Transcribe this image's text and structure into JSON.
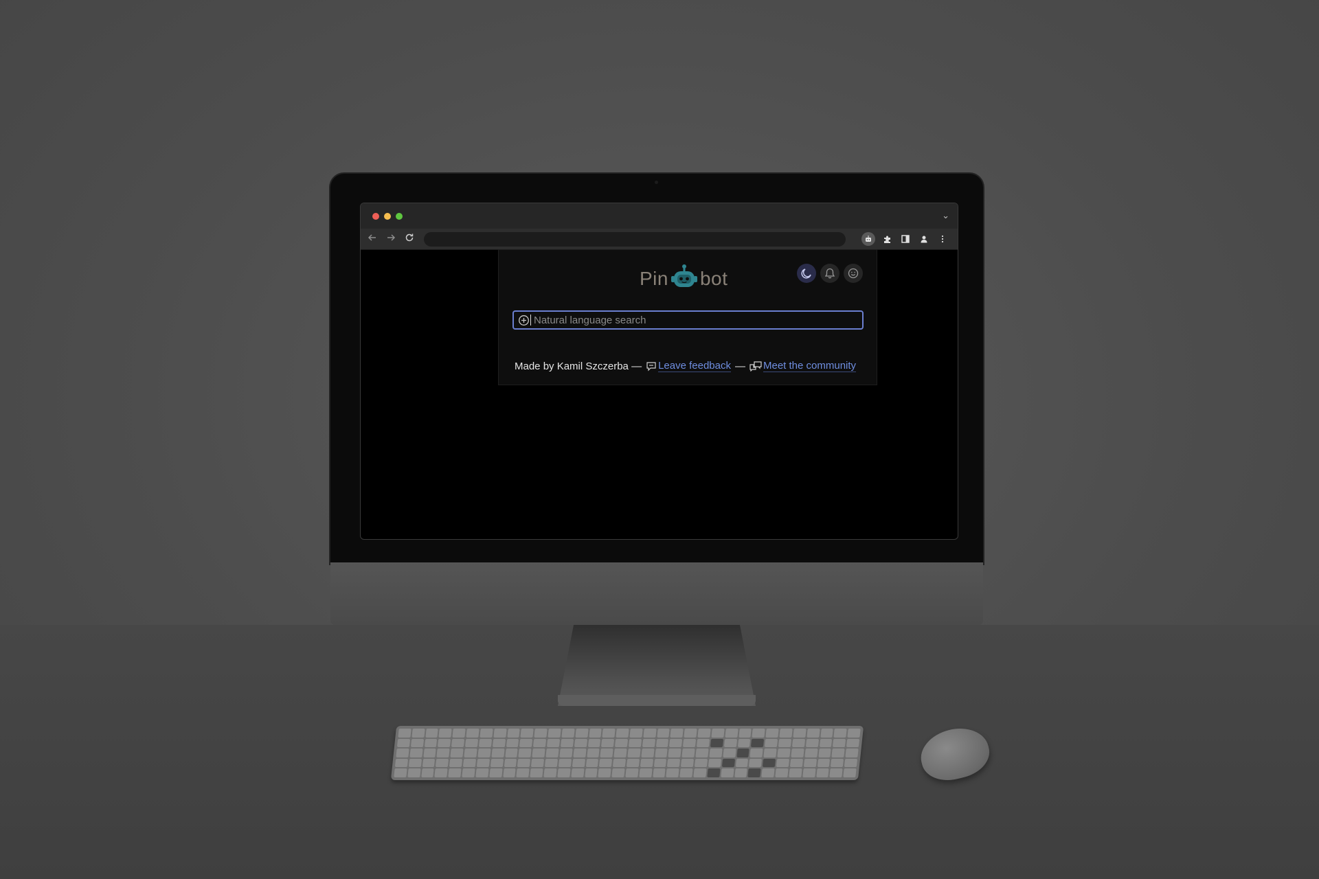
{
  "popup": {
    "logo_left": "Pin",
    "logo_right": "bot",
    "search": {
      "placeholder": "Natural language search",
      "value": ""
    },
    "header_icons": [
      "moon-icon",
      "bell-icon",
      "smiley-icon"
    ],
    "footer": {
      "made_by": "Made by Kamil Szczerba —",
      "separator": "—",
      "feedback_label": "Leave feedback",
      "community_label": "Meet the community"
    }
  },
  "browser": {
    "toolbar_icons": [
      "back-arrow-icon",
      "forward-arrow-icon",
      "reload-icon",
      "robot-extension-icon",
      "puzzle-icon",
      "side-panel-icon",
      "profile-icon",
      "kebab-menu-icon"
    ],
    "tab_dropdown_glyph": "⌄"
  },
  "colors": {
    "accent": "#6f8ee0",
    "logo_teal": "#2f8590",
    "logo_text": "#8a8278",
    "search_border": "#6b7fd0",
    "popup_bg": "#0e0e0e",
    "traffic_red": "#ee5f57",
    "traffic_yellow": "#f5bd4f",
    "traffic_green": "#5fc640"
  }
}
